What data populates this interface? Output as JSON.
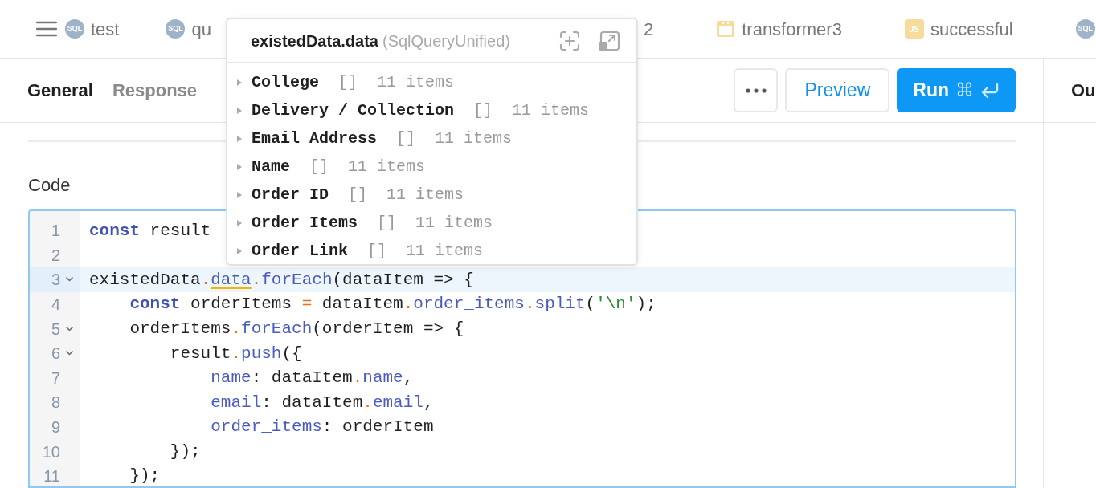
{
  "top_tabs": [
    {
      "kind": "sql",
      "badge": "SQL",
      "label": "test"
    },
    {
      "kind": "sql",
      "badge": "SQL",
      "label": "qu"
    },
    {
      "kind": "none",
      "label": "2"
    },
    {
      "kind": "transformer",
      "label": "transformer3"
    },
    {
      "kind": "js",
      "badge": "JS",
      "label": "successful"
    },
    {
      "kind": "sql",
      "badge": "SQL"
    }
  ],
  "panel_tabs": [
    {
      "label": "General",
      "selected": true
    },
    {
      "label": "Response",
      "selected": false
    }
  ],
  "preview_button": "Preview",
  "run_button": {
    "label": "Run",
    "shortcut": "⌘"
  },
  "right_panel_title": "Ou",
  "code_label": "Code",
  "code_lines": [
    {
      "number": "1",
      "fold": false,
      "highlighted": false,
      "tokens": [
        {
          "kind": "kw",
          "t": "const"
        },
        {
          "kind": "plain",
          "t": " result"
        }
      ]
    },
    {
      "number": "2",
      "fold": false,
      "highlighted": false
    },
    {
      "number": "3",
      "fold": true,
      "highlighted": true,
      "tokens": [
        {
          "kind": "plain",
          "t": "existedData"
        },
        {
          "kind": "dot",
          "t": "."
        },
        {
          "kind": "warn",
          "t": "data"
        },
        {
          "kind": "dot",
          "t": "."
        },
        {
          "kind": "prop",
          "t": "forEach"
        },
        {
          "kind": "plain",
          "t": "(dataItem => {"
        }
      ]
    },
    {
      "number": "4",
      "fold": false,
      "highlighted": false,
      "tokens": [
        {
          "kind": "kw",
          "t": "    const"
        },
        {
          "kind": "plain",
          "t": " orderItems "
        },
        {
          "kind": "dot",
          "t": "="
        },
        {
          "kind": "plain",
          "t": " dataItem"
        },
        {
          "kind": "dot",
          "t": "."
        },
        {
          "kind": "prop",
          "t": "order_items"
        },
        {
          "kind": "dot",
          "t": "."
        },
        {
          "kind": "prop",
          "t": "split"
        },
        {
          "kind": "plain",
          "t": "("
        },
        {
          "kind": "str",
          "t": "'\\n'"
        },
        {
          "kind": "plain",
          "t": ");"
        }
      ]
    },
    {
      "number": "5",
      "fold": true,
      "highlighted": false,
      "tokens": [
        {
          "kind": "plain",
          "t": "    orderItems"
        },
        {
          "kind": "dot",
          "t": "."
        },
        {
          "kind": "prop",
          "t": "forEach"
        },
        {
          "kind": "plain",
          "t": "(orderItem => {"
        }
      ]
    },
    {
      "number": "6",
      "fold": true,
      "highlighted": false,
      "tokens": [
        {
          "kind": "plain",
          "t": "        result"
        },
        {
          "kind": "dot",
          "t": "."
        },
        {
          "kind": "prop",
          "t": "push"
        },
        {
          "kind": "plain",
          "t": "({"
        }
      ]
    },
    {
      "number": "7",
      "fold": false,
      "highlighted": false,
      "tokens": [
        {
          "kind": "prop",
          "t": "            name"
        },
        {
          "kind": "plain",
          "t": ": dataItem"
        },
        {
          "kind": "dot",
          "t": "."
        },
        {
          "kind": "prop",
          "t": "name"
        },
        {
          "kind": "plain",
          "t": ","
        }
      ]
    },
    {
      "number": "8",
      "fold": false,
      "highlighted": false,
      "tokens": [
        {
          "kind": "prop",
          "t": "            email"
        },
        {
          "kind": "plain",
          "t": ": dataItem"
        },
        {
          "kind": "dot",
          "t": "."
        },
        {
          "kind": "prop",
          "t": "email"
        },
        {
          "kind": "plain",
          "t": ","
        }
      ]
    },
    {
      "number": "9",
      "fold": false,
      "highlighted": false,
      "tokens": [
        {
          "kind": "prop",
          "t": "            order_items"
        },
        {
          "kind": "plain",
          "t": ": orderItem"
        }
      ]
    },
    {
      "number": "10",
      "fold": false,
      "highlighted": false,
      "tokens": [
        {
          "kind": "plain",
          "t": "        });"
        }
      ]
    },
    {
      "number": "11",
      "fold": false,
      "highlighted": false,
      "tokens": [
        {
          "kind": "plain",
          "t": "    });"
        }
      ]
    }
  ],
  "popup": {
    "title": "existedData.data",
    "type": "(SqlQueryUnified)",
    "rows": [
      {
        "key": "College",
        "bracket": "[]",
        "count": "11 items",
        "expanded": false
      },
      {
        "key": "Delivery / Collection",
        "bracket": "[]",
        "count": "11 items",
        "expanded": false
      },
      {
        "key": "Email Address",
        "bracket": "[]",
        "count": "11 items",
        "expanded": false
      },
      {
        "key": "Name",
        "bracket": "[]",
        "count": "11 items",
        "expanded": false
      },
      {
        "key": "Order ID",
        "bracket": "[]",
        "count": "11 items",
        "expanded": false
      },
      {
        "key": "Order Items",
        "bracket": "[]",
        "count": "11 items",
        "expanded": false
      },
      {
        "key": "Order Link",
        "bracket": "[]",
        "count": "11 items",
        "expanded": false
      }
    ]
  }
}
